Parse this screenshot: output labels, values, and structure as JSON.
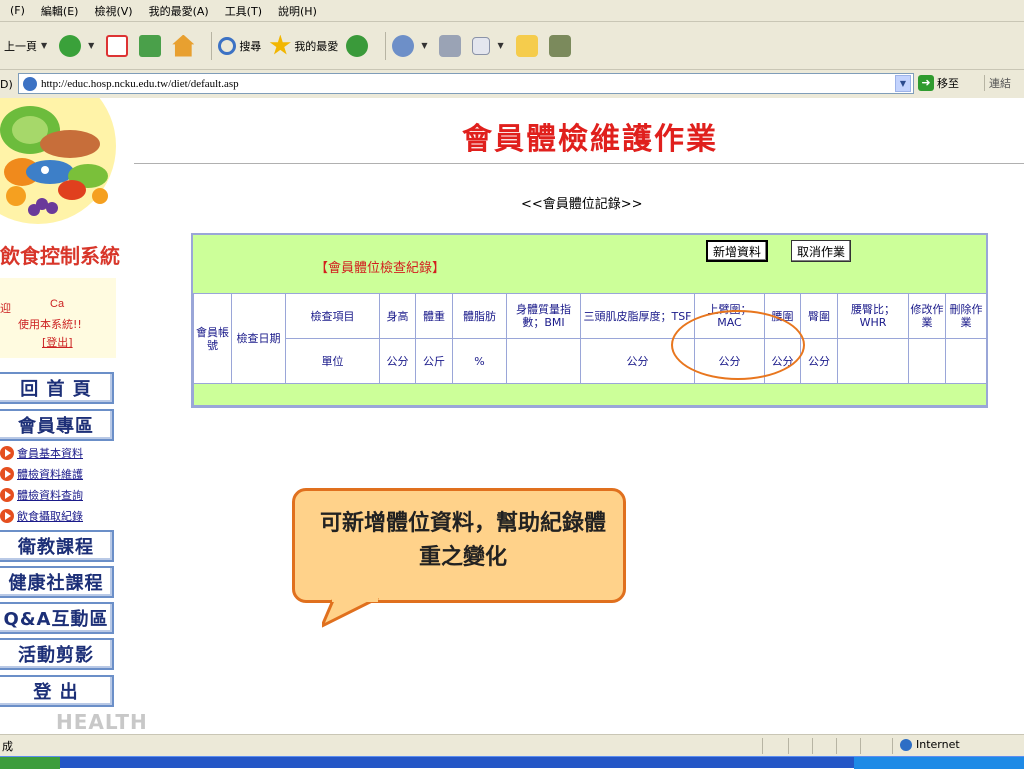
{
  "menu": [
    "(F)",
    "編輯(E)",
    "檢視(V)",
    "我的最愛(A)",
    "工具(T)",
    "說明(H)"
  ],
  "toolbar": {
    "back": "上一頁",
    "search": "搜尋",
    "favorites": "我的最愛"
  },
  "address": {
    "label": "D)",
    "url": "http://educ.hosp.ncku.edu.tw/diet/default.asp",
    "go": "移至",
    "links": "連結"
  },
  "sidebar": {
    "system_title": "飲食控制系統",
    "welcome_char": "迎",
    "welcome_user": "Ca",
    "welcome_text": "使用本系統!!",
    "logout": "[登出]",
    "buttons": [
      "回 首 頁",
      "會員專區",
      "衛教課程",
      "健康社課程",
      "Q&A互動區",
      "活動剪影",
      "登    出"
    ],
    "sub_links": [
      "會員基本資料",
      "體檢資料維護",
      "體檢資料查詢",
      "飲食攝取紀錄"
    ],
    "footer": "HEALTH"
  },
  "main": {
    "page_title": "會員體檢維護作業",
    "subtitle": "<<會員體位記錄>>",
    "panel_title": "【會員體位檢查紀錄】",
    "add_button": "新增資料",
    "cancel_button": "取消作業"
  },
  "table": {
    "account": "會員帳號",
    "date": "檢查日期",
    "item_header": "檢查項目",
    "unit_header": "單位",
    "columns": [
      {
        "name": "身高",
        "unit": "公分"
      },
      {
        "name": "體重",
        "unit": "公斤"
      },
      {
        "name": "體脂肪",
        "unit": "%"
      },
      {
        "name": "身體質量指數；BMI",
        "unit": ""
      },
      {
        "name": "三頭肌皮脂厚度；TSF",
        "unit": "公分"
      },
      {
        "name": "上臂圍；MAC",
        "unit": "公分"
      },
      {
        "name": "腰圍",
        "unit": "公分"
      },
      {
        "name": "臀圍",
        "unit": "公分"
      },
      {
        "name": "腰臀比；WHR",
        "unit": ""
      },
      {
        "name": "修改作業",
        "unit": ""
      },
      {
        "name": "刪除作業",
        "unit": ""
      }
    ]
  },
  "callout": "可新增體位資料，幫助紀錄體重之變化",
  "status": {
    "text": "成",
    "zone": "Internet"
  },
  "colors": {
    "title_red": "#e0201d",
    "panel_green": "#ccff99",
    "callout_fill": "#ffd28a",
    "callout_border": "#e0701e",
    "highlight_ring": "#e8761e"
  }
}
